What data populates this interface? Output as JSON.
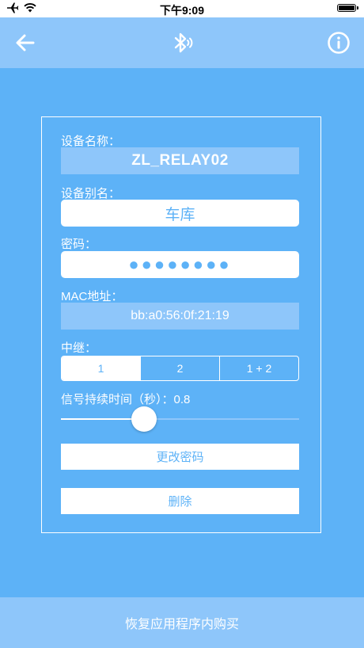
{
  "status_bar": {
    "time": "下午9:09",
    "icons": [
      "airplane-icon",
      "wifi-icon",
      "battery-icon"
    ]
  },
  "nav": {
    "back_icon": "back-arrow-icon",
    "center_icon": "bluetooth-icon",
    "right_icon": "info-icon"
  },
  "form": {
    "device_name_label": "设备名称：",
    "device_name_value": "ZL_RELAY02",
    "alias_label": "设备别名：",
    "alias_value": "车库",
    "password_label": "密码：",
    "password_value": "●●●●●●●●",
    "mac_label": "MAC地址：",
    "mac_value": "bb:a0:56:0f:21:19",
    "relay_label": "中继：",
    "relay_options": [
      "1",
      "2",
      "1 + 2"
    ],
    "relay_selected": "1",
    "signal_label": "信号持续时间（秒）：0.8",
    "signal_value": 0.8,
    "signal_slider_fraction": 0.35
  },
  "buttons": {
    "change_password": "更改密码",
    "delete": "删除"
  },
  "footer": {
    "restore_purchases": "恢复应用程序内购买"
  },
  "colors": {
    "background": "#5db2f7",
    "bar": "#8ec6fa",
    "accent": "#5db2f7",
    "white": "#ffffff"
  }
}
